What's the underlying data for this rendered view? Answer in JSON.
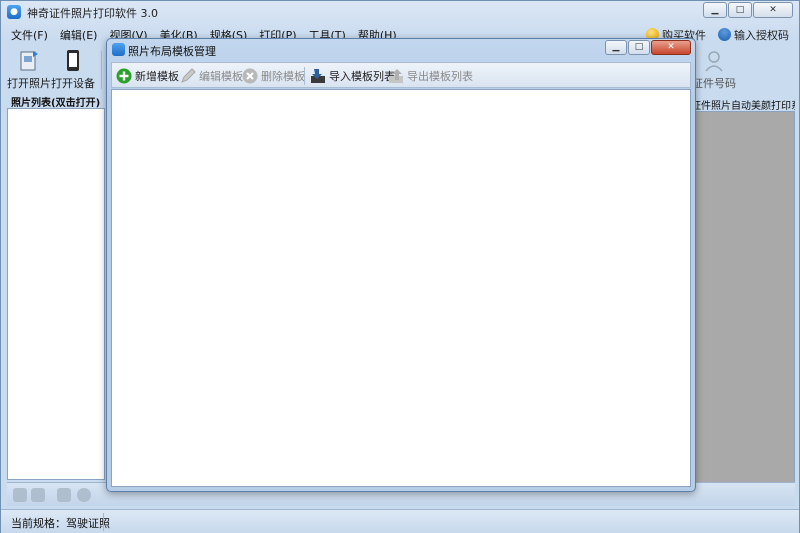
{
  "app": {
    "title": "神奇证件照片打印软件 3.0"
  },
  "menu": [
    "文件(F)",
    "编辑(E)",
    "视图(V)",
    "美化(B)",
    "规格(S)",
    "打印(P)",
    "工具(T)",
    "帮助(H)"
  ],
  "top_right": {
    "buy": "购买软件",
    "license": "输入授权码"
  },
  "toolbar": {
    "open_photo": "打开照片",
    "open_device": "打开设备",
    "id_number": "证件号码"
  },
  "sidebar": {
    "header": "照片列表(双击打开)"
  },
  "right_panel": {
    "header": "证件照片自动美颜打印系统"
  },
  "status": {
    "current_spec": "当前规格：驾驶证照"
  },
  "dialog": {
    "title": "照片布局模板管理",
    "toolbar": {
      "new": "新增模板",
      "edit": "编辑模板",
      "delete": "删除模板",
      "import": "导入模板列表",
      "export": "导出模板列表"
    }
  },
  "colors": {
    "accent": "#1d6ec8",
    "add_green": "#2ca02c",
    "disabled": "#8a8a8a"
  }
}
